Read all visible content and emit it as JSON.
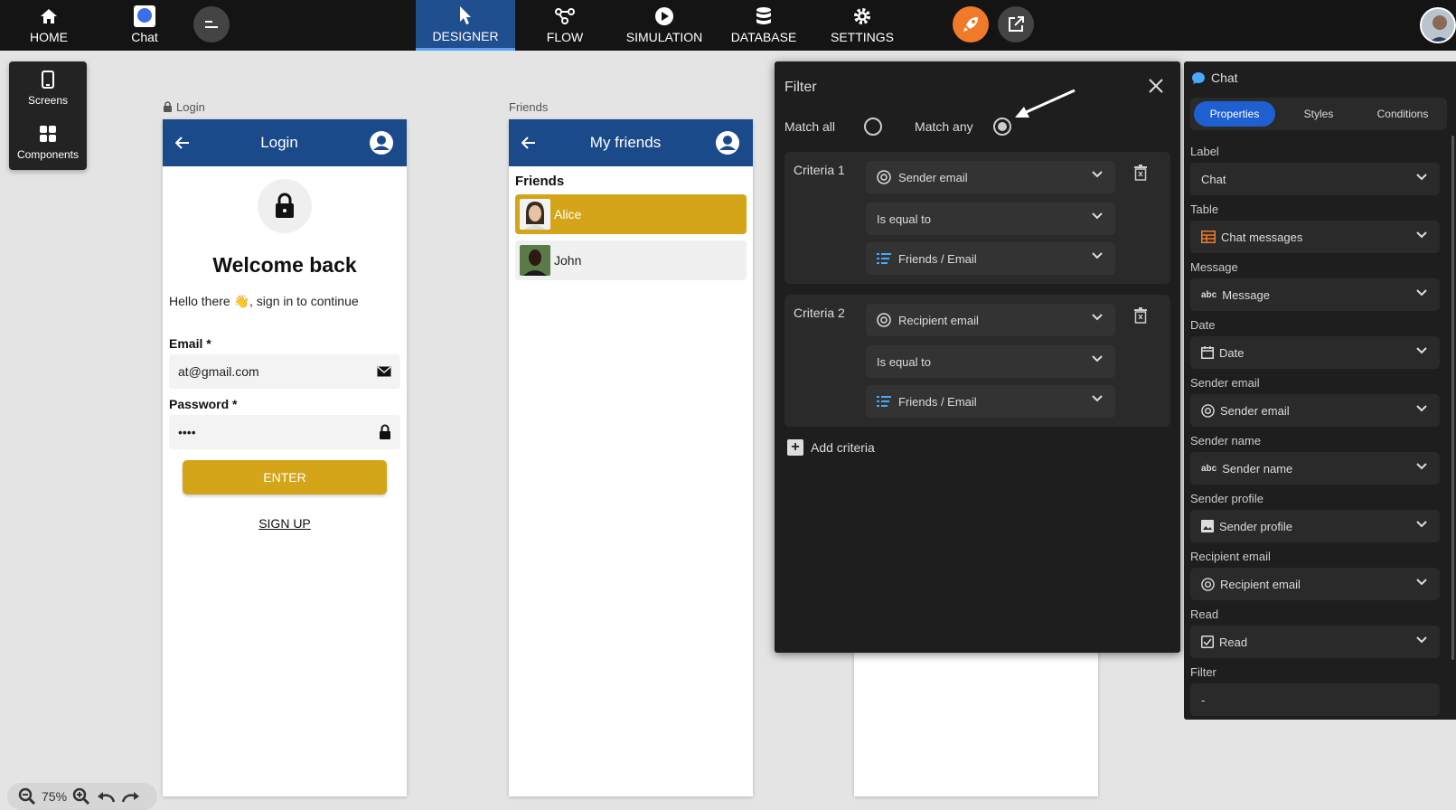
{
  "nav": {
    "home": "HOME",
    "chat": "Chat",
    "designer": "DESIGNER",
    "flow": "FLOW",
    "simulation": "SIMULATION",
    "database": "DATABASE",
    "settings": "SETTINGS"
  },
  "tools": {
    "screens": "Screens",
    "components": "Components"
  },
  "login_screen": {
    "caption": "Login",
    "title": "Login",
    "welcome": "Welcome back",
    "hello_prefix": "Hello there",
    "hello_emoji": "👋",
    "hello_suffix": ", sign in to continue",
    "email_label": "Email *",
    "email_value": "at@gmail.com",
    "password_label": "Password *",
    "password_value": "••••",
    "enter": "ENTER",
    "signup": "SIGN UP"
  },
  "friends_screen": {
    "caption": "Friends",
    "title": "My friends",
    "section": "Friends",
    "items": [
      {
        "name": "Alice",
        "selected": true
      },
      {
        "name": "John",
        "selected": false
      }
    ]
  },
  "filter": {
    "title": "Filter",
    "match_all": "Match all",
    "match_any": "Match any",
    "selected_match": "any",
    "criteria": [
      {
        "label": "Criteria 1",
        "field": "Sender email",
        "operator": "Is equal to",
        "value": "Friends / Email"
      },
      {
        "label": "Criteria 2",
        "field": "Recipient email",
        "operator": "Is equal to",
        "value": "Friends / Email"
      }
    ],
    "add_criteria": "Add criteria"
  },
  "props": {
    "title": "Chat",
    "tabs": [
      "Properties",
      "Styles",
      "Conditions"
    ],
    "fields": [
      {
        "label": "Label",
        "value": "Chat",
        "icon": "none"
      },
      {
        "label": "Table",
        "value": "Chat messages",
        "icon": "table-icon"
      },
      {
        "label": "Message",
        "value": "Message",
        "icon": "abc-icon"
      },
      {
        "label": "Date",
        "value": "Date",
        "icon": "calendar-icon"
      },
      {
        "label": "Sender email",
        "value": "Sender email",
        "icon": "at-icon"
      },
      {
        "label": "Sender name",
        "value": "Sender name",
        "icon": "abc-icon"
      },
      {
        "label": "Sender profile",
        "value": "Sender profile",
        "icon": "image-icon"
      },
      {
        "label": "Recipient email",
        "value": "Recipient email",
        "icon": "at-icon"
      },
      {
        "label": "Read",
        "value": "Read",
        "icon": "checkbox-icon"
      },
      {
        "label": "Filter",
        "value": "-",
        "icon": "none"
      }
    ]
  },
  "zoom": {
    "level": "75%"
  },
  "colors": {
    "header_blue": "#1a4a8a",
    "gold": "#d4a419",
    "accent_blue": "#1f60d0",
    "rocket_orange": "#f07a2a"
  }
}
